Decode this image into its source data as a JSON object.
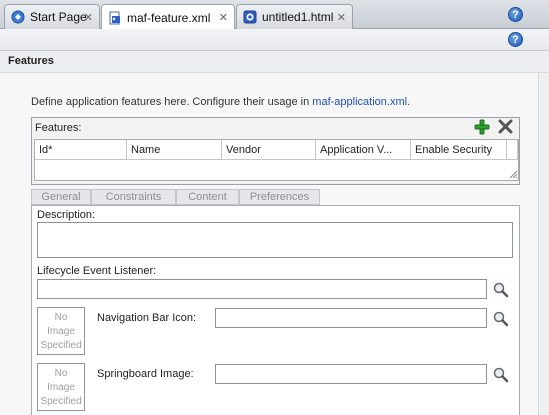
{
  "tabs": [
    {
      "label": "Start Page",
      "icon": "start-page-icon",
      "active": false
    },
    {
      "label": "maf-feature.xml",
      "icon": "xml-file-icon",
      "active": true
    },
    {
      "label": "untitled1.html",
      "icon": "html-file-icon",
      "active": false
    }
  ],
  "section": {
    "title": "Features"
  },
  "description": {
    "text": "Define application features here. Configure their usage in ",
    "link": "maf-application.xml",
    "suffix": "."
  },
  "features_panel": {
    "label": "Features:",
    "columns": [
      "Id*",
      "Name",
      "Vendor",
      "Application V...",
      "Enable Security"
    ]
  },
  "subtabs": [
    "General",
    "Constraints",
    "Content",
    "Preferences"
  ],
  "form": {
    "description_label": "Description:",
    "lifecycle_label": "Lifecycle Event Listener:",
    "nav_icon_label": "Navigation Bar Icon:",
    "springboard_label": "Springboard Image:",
    "no_image_text_1": "No\nImage\nSpecified",
    "no_image_text_2": "No\nImage\nSpecified"
  },
  "colors": {
    "link": "#1f4fb8",
    "add": "#2ca02c",
    "help": "#1d5ab8"
  }
}
